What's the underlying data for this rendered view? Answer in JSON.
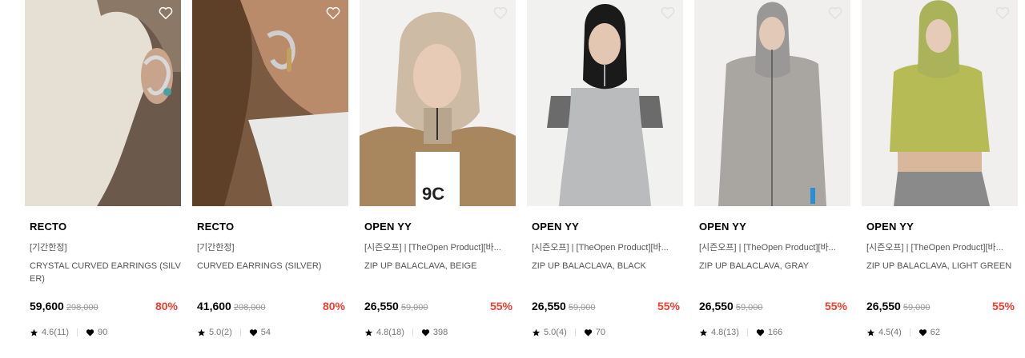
{
  "products": [
    {
      "brand": "RECTO",
      "tag": "[기간한정]",
      "name": "CRYSTAL CURVED EARRINGS (SILVER)",
      "price": "59,600",
      "original_price": "298,000",
      "discount": "80%",
      "rating": "4.6(11)",
      "likes": "90"
    },
    {
      "brand": "RECTO",
      "tag": "[기간한정]",
      "name": "CURVED EARRINGS (SILVER)",
      "price": "41,600",
      "original_price": "208,000",
      "discount": "80%",
      "rating": "5.0(2)",
      "likes": "54"
    },
    {
      "brand": "OPEN YY",
      "tag": "[시즌오프] | [TheOpen Product][바...",
      "name": "ZIP UP BALACLAVA, BEIGE",
      "price": "26,550",
      "original_price": "59,000",
      "discount": "55%",
      "rating": "4.8(18)",
      "likes": "398"
    },
    {
      "brand": "OPEN YY",
      "tag": "[시즌오프] | [TheOpen Product][바...",
      "name": "ZIP UP BALACLAVA, BLACK",
      "price": "26,550",
      "original_price": "59,000",
      "discount": "55%",
      "rating": "5.0(4)",
      "likes": "70"
    },
    {
      "brand": "OPEN YY",
      "tag": "[시즌오프] | [TheOpen Product][바...",
      "name": "ZIP UP BALACLAVA, GRAY",
      "price": "26,550",
      "original_price": "59,000",
      "discount": "55%",
      "rating": "4.8(13)",
      "likes": "166"
    },
    {
      "brand": "OPEN YY",
      "tag": "[시즌오프] | [TheOpen Product][바...",
      "name": "ZIP UP BALACLAVA, LIGHT GREEN",
      "price": "26,550",
      "original_price": "59,000",
      "discount": "55%",
      "rating": "4.5(4)",
      "likes": "62"
    }
  ],
  "colors": {
    "discount": "#ef3e2f",
    "muted": "#555555",
    "strike": "#999999"
  },
  "icons": {
    "wishlist": "heart-outline-icon",
    "rating": "star-icon",
    "likes": "heart-filled-icon"
  }
}
